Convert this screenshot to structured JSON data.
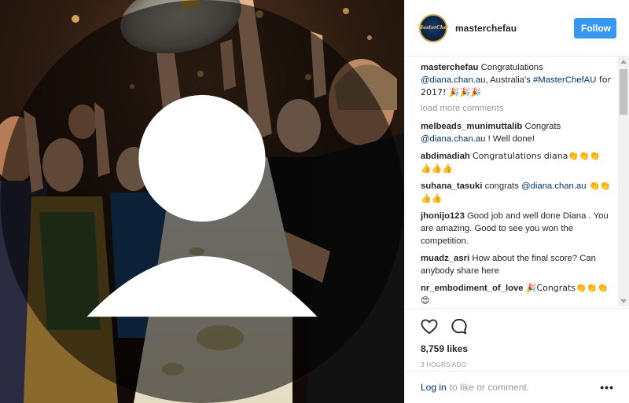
{
  "header": {
    "username": "masterchefau",
    "avatar_text": "MasterChef",
    "follow_label": "Follow"
  },
  "caption": {
    "user": "masterchefau",
    "text_pre": "Congratulations ",
    "mention": "@diana.chan.au",
    "text_mid": ", Australia's ",
    "hashtag": "#MasterChefAU",
    "text_post": " for 2017! 🎉🎉🎉"
  },
  "load_more": "load more comments",
  "comments": [
    {
      "user": "melbeads_munimuttalib",
      "text_pre": "Congrats ",
      "mention": "@diana.chan.au",
      "text_post": " ! Well done!"
    },
    {
      "user": "abdimadiah",
      "text_pre": "Congratulations diana👏👏👏👍👍👍",
      "mention": "",
      "text_post": ""
    },
    {
      "user": "suhana_tasuki",
      "text_pre": "congrats ",
      "mention": "@diana.chan.au",
      "text_post": " 👏👏👍👍"
    },
    {
      "user": "jhonijo123",
      "text_pre": "Good job and well done Diana . You are amazing. Good to see you won the competition.",
      "mention": "",
      "text_post": ""
    },
    {
      "user": "muadz_asri",
      "text_pre": "How about the final score? Can anybody share here",
      "mention": "",
      "text_post": ""
    },
    {
      "user": "nr_embodiment_of_love",
      "text_pre": "🎉Congrats👏👏👏😍",
      "mention": "",
      "text_post": ""
    }
  ],
  "likes": "8,759 likes",
  "timestamp": "3 HOURS AGO",
  "footer": {
    "login_label": "Log in",
    "login_rest": "to like or comment.",
    "more_label": "•••"
  },
  "icons": {
    "like": "heart-icon",
    "comment": "comment-bubble-icon",
    "more": "more-options-icon",
    "user_tag": "user-tag-icon"
  },
  "colors": {
    "follow_button": "#3897f0",
    "link": "#003569",
    "muted": "#999999"
  }
}
